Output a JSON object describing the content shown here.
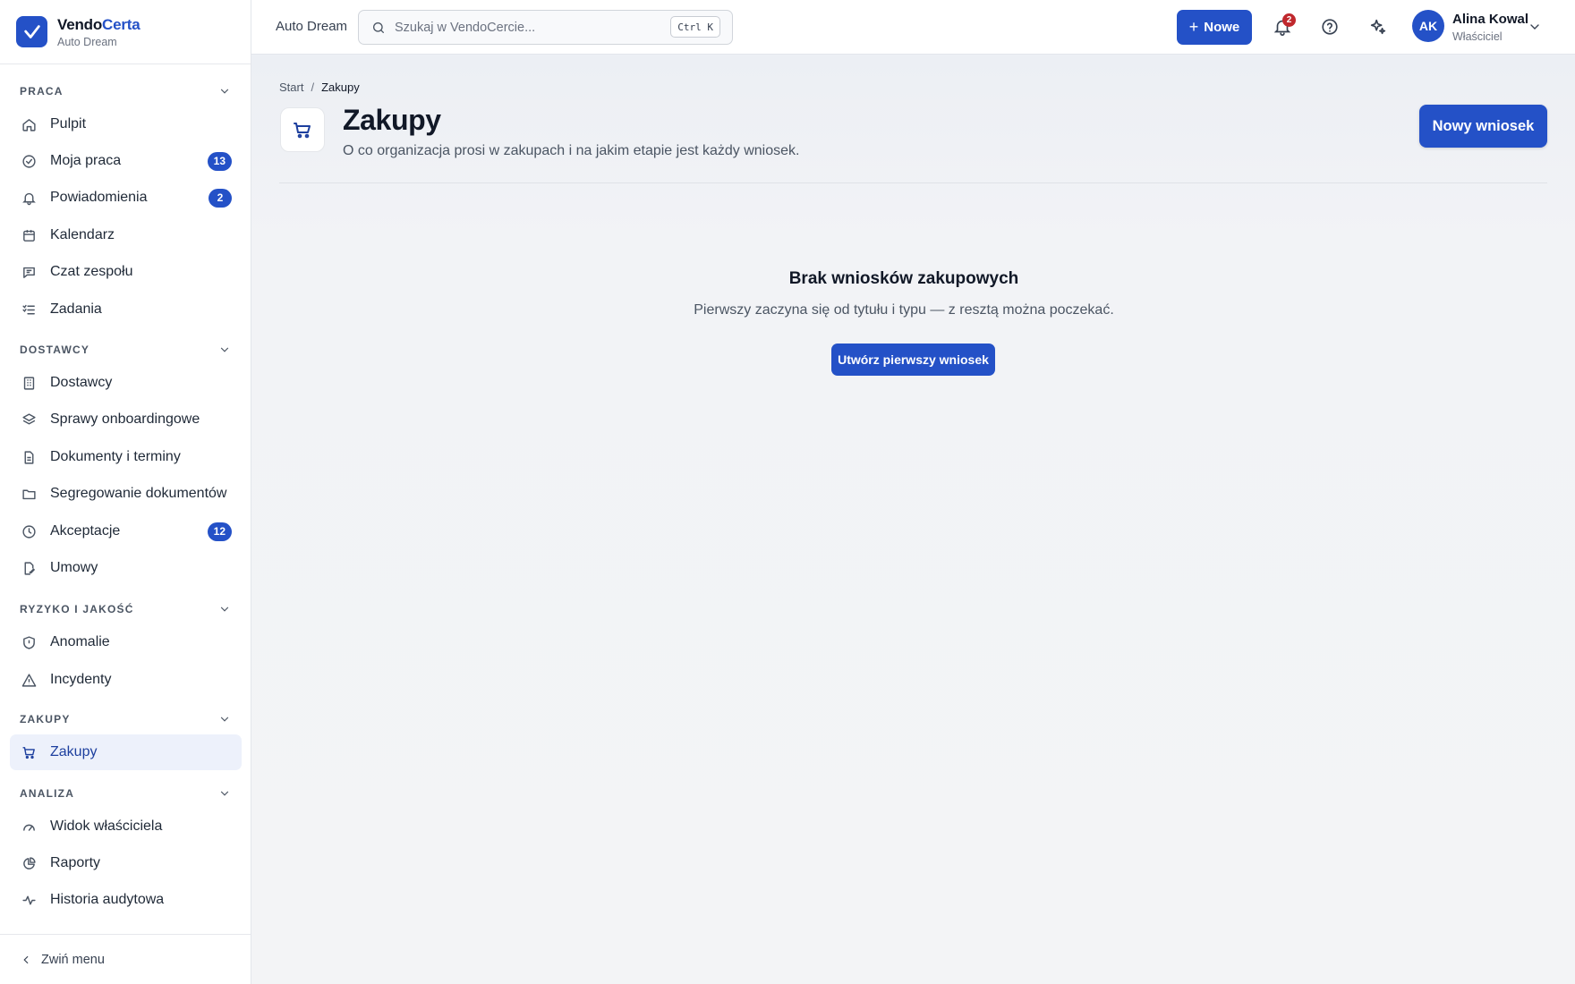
{
  "brand": {
    "name_part1": "Vendo",
    "name_part2": "Certa",
    "org": "Auto Dream"
  },
  "sidebar": {
    "sections": [
      {
        "title": "PRACA",
        "items": [
          {
            "label": "Pulpit",
            "icon": "home-icon"
          },
          {
            "label": "Moja praca",
            "icon": "check-circle-icon",
            "badge": "13"
          },
          {
            "label": "Powiadomienia",
            "icon": "bell-icon",
            "badge": "2"
          },
          {
            "label": "Kalendarz",
            "icon": "calendar-icon"
          },
          {
            "label": "Czat zespołu",
            "icon": "chat-icon"
          },
          {
            "label": "Zadania",
            "icon": "list-check-icon"
          }
        ]
      },
      {
        "title": "DOSTAWCY",
        "items": [
          {
            "label": "Dostawcy",
            "icon": "building-icon"
          },
          {
            "label": "Sprawy onboardingowe",
            "icon": "layers-icon"
          },
          {
            "label": "Dokumenty i terminy",
            "icon": "file-icon"
          },
          {
            "label": "Segregowanie dokumentów",
            "icon": "folder-icon"
          },
          {
            "label": "Akceptacje",
            "icon": "clock-icon",
            "badge": "12"
          },
          {
            "label": "Umowy",
            "icon": "file-signature-icon"
          }
        ]
      },
      {
        "title": "RYZYKO I JAKOŚĆ",
        "items": [
          {
            "label": "Anomalie",
            "icon": "shield-icon"
          },
          {
            "label": "Incydenty",
            "icon": "warning-icon"
          }
        ]
      },
      {
        "title": "ZAKUPY",
        "items": [
          {
            "label": "Zakupy",
            "icon": "cart-icon",
            "active": true
          }
        ]
      },
      {
        "title": "ANALIZA",
        "items": [
          {
            "label": "Widok właściciela",
            "icon": "gauge-icon"
          },
          {
            "label": "Raporty",
            "icon": "pie-chart-icon"
          },
          {
            "label": "Historia audytowa",
            "icon": "activity-icon"
          }
        ]
      }
    ],
    "collapse_label": "Zwiń menu"
  },
  "topbar": {
    "org_name": "Auto Dream",
    "search_placeholder": "Szukaj w VendoCercie...",
    "search_shortcut": "Ctrl K",
    "new_button": "Nowe",
    "notification_count": "2",
    "user": {
      "initials": "AK",
      "name": "Alina Kowal",
      "role": "Właściciel"
    }
  },
  "main": {
    "breadcrumb": {
      "home": "Start",
      "separator": "/",
      "current": "Zakupy"
    },
    "title": "Zakupy",
    "subtitle": "O co organizacja prosi w zakupach i na jakim etapie jest każdy wniosek.",
    "primary_button": "Nowy wniosek",
    "empty": {
      "title": "Brak wniosków zakupowych",
      "subtitle": "Pierwszy zaczyna się od tytułu i typu — z resztą można poczekać.",
      "button": "Utwórz pierwszy wniosek"
    }
  },
  "colors": {
    "accent": "#2451c7",
    "active_bg": "#edf1fb",
    "danger": "#c0282d"
  }
}
